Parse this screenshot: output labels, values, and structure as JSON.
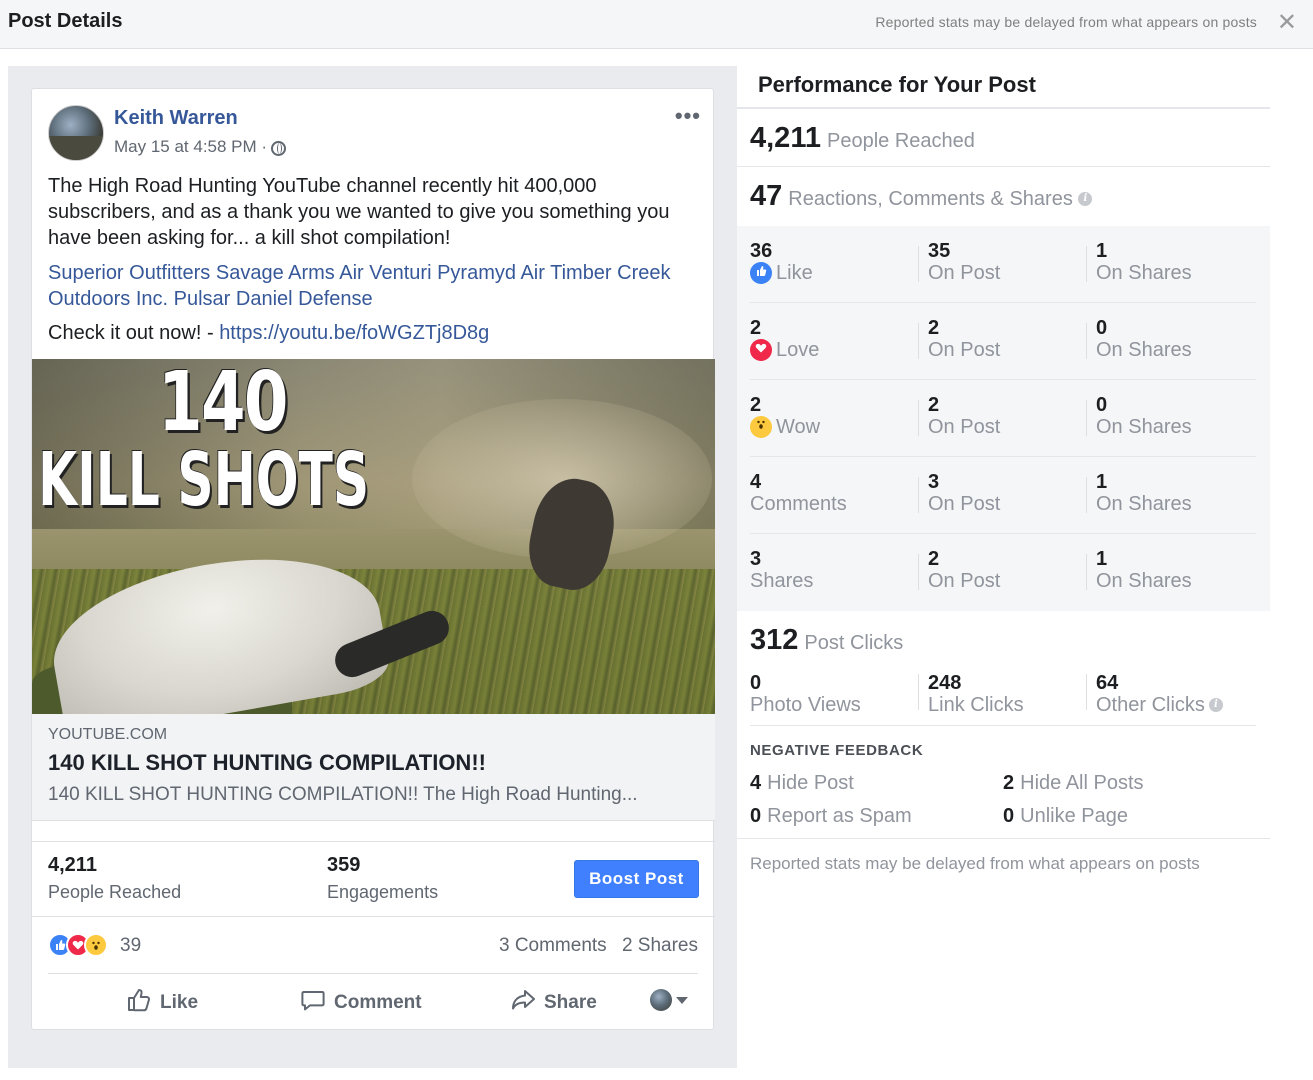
{
  "topbar": {
    "title": "Post Details",
    "delay_note": "Reported stats may be delayed from what appears on posts",
    "close_glyph": "✕"
  },
  "post": {
    "author": "Keith Warren",
    "timestamp": "May 15 at 4:58 PM ·",
    "more_glyph": "•••",
    "text": "The High Road Hunting YouTube channel recently hit 400,000 subscribers, and as a thank you we wanted to give you something you have been asking for... a kill shot compilation!",
    "tags": [
      "Superior Outfitters",
      "Savage Arms",
      "Air Venturi",
      "Pyramyd Air",
      "Timber Creek Outdoors Inc.",
      "Pulsar",
      "Daniel Defense"
    ],
    "check_prefix": "Check it out now! - ",
    "check_link": "https://youtu.be/foWGZTj8D8g",
    "image": {
      "number": "140",
      "words": "KILL SHOTS"
    },
    "link_preview": {
      "domain": "YOUTUBE.COM",
      "headline": "140 KILL SHOT HUNTING COMPILATION!!",
      "description": "140 KILL SHOT HUNTING COMPILATION!! The High Road Hunting..."
    },
    "stats": {
      "reached_value": "4,211",
      "reached_label": "People Reached",
      "engagements_value": "359",
      "engagements_label": "Engagements",
      "boost_label": "Boost Post"
    },
    "reactions": {
      "count": "39",
      "comments": "3 Comments",
      "shares": "2 Shares"
    },
    "actions": {
      "like": "Like",
      "comment": "Comment",
      "share": "Share"
    }
  },
  "performance": {
    "title": "Performance for Your Post",
    "reached_value": "4,211",
    "reached_label": "People Reached",
    "rcs_value": "47",
    "rcs_label": "Reactions, Comments & Shares",
    "breakdown": [
      {
        "total": "36",
        "label": "Like",
        "icon": "like-icon",
        "on_post": "35",
        "on_shares": "1"
      },
      {
        "total": "2",
        "label": "Love",
        "icon": "love-icon",
        "on_post": "2",
        "on_shares": "0"
      },
      {
        "total": "2",
        "label": "Wow",
        "icon": "wow-icon",
        "on_post": "2",
        "on_shares": "0"
      },
      {
        "total": "4",
        "label": "Comments",
        "icon": "",
        "on_post": "3",
        "on_shares": "1"
      },
      {
        "total": "3",
        "label": "Shares",
        "icon": "",
        "on_post": "2",
        "on_shares": "1"
      }
    ],
    "on_post_label": "On Post",
    "on_shares_label": "On Shares",
    "clicks_value": "312",
    "clicks_label": "Post Clicks",
    "clicks": [
      {
        "value": "0",
        "label": "Photo Views"
      },
      {
        "value": "248",
        "label": "Link Clicks"
      },
      {
        "value": "64",
        "label": "Other Clicks"
      }
    ],
    "negative_title": "NEGATIVE FEEDBACK",
    "negative": {
      "hide_post_value": "4",
      "hide_post_label": "Hide Post",
      "hide_all_value": "2",
      "hide_all_label": "Hide All Posts",
      "spam_value": "0",
      "spam_label": "Report as Spam",
      "unlike_value": "0",
      "unlike_label": "Unlike Page"
    },
    "footer_note": "Reported stats may be delayed from what appears on posts"
  },
  "colors": {
    "link": "#365899",
    "boost": "#4080ff",
    "like": "#3b82f6",
    "love": "#f0284a",
    "wow": "#fcc93f"
  }
}
